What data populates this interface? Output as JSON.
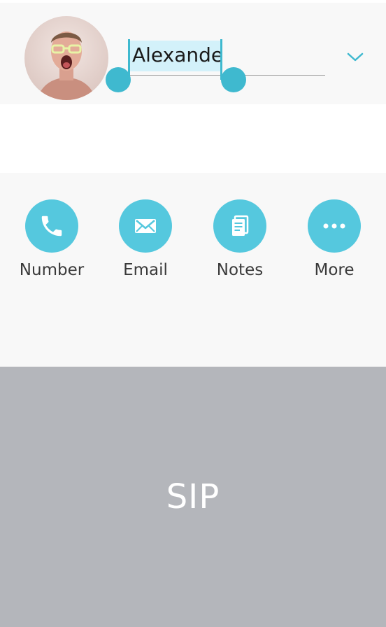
{
  "contact": {
    "name_value": "Alexande",
    "avatar": "contact-photo"
  },
  "actions": [
    {
      "label": "Number",
      "icon": "phone-icon"
    },
    {
      "label": "Email",
      "icon": "envelope-icon"
    },
    {
      "label": "Notes",
      "icon": "notes-icon"
    },
    {
      "label": "More",
      "icon": "more-dots-icon"
    }
  ],
  "sip": {
    "label": "SIP"
  },
  "colors": {
    "accent": "#55c8de",
    "handle": "#3fb9cf",
    "selection": "#d3f1fa",
    "sip_background": "#b4b6bb"
  }
}
